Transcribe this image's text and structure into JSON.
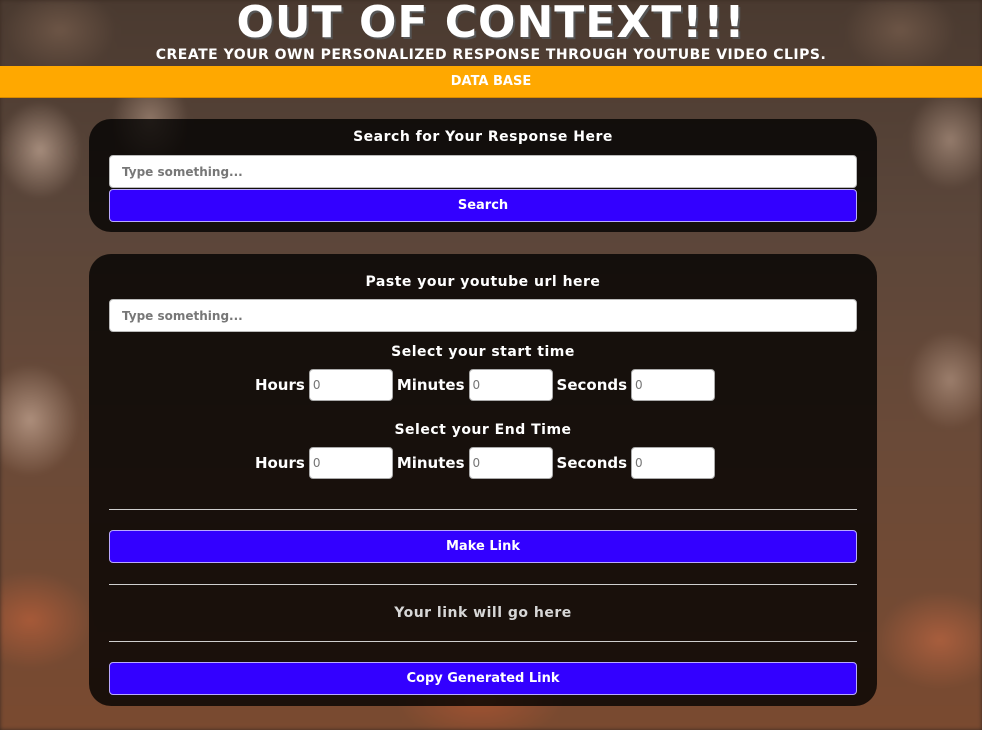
{
  "header": {
    "title": "OUT OF CONTEXT!!!",
    "subtitle": "CREATE YOUR OWN PERSONALIZED RESPONSE THROUGH YOUTUBE VIDEO CLIPS."
  },
  "nav": {
    "link_label": "DATA BASE"
  },
  "search_panel": {
    "heading": "Search for Your Response Here",
    "input_placeholder": "Type something...",
    "button_label": "Search"
  },
  "clip_panel": {
    "url_heading": "Paste your youtube url here",
    "url_placeholder": "Type something...",
    "start_heading": "Select your start time",
    "end_heading": "Select your End Time",
    "hours_label": "Hours",
    "minutes_label": "Minutes",
    "seconds_label": "Seconds",
    "time_placeholder": "0",
    "make_link_label": "Make Link",
    "link_output_text": "Your link will go here",
    "copy_label": "Copy Generated Link"
  },
  "colors": {
    "accent_button": "#3300ff",
    "nav_bar": "#ffa800",
    "panel": "#000000"
  }
}
